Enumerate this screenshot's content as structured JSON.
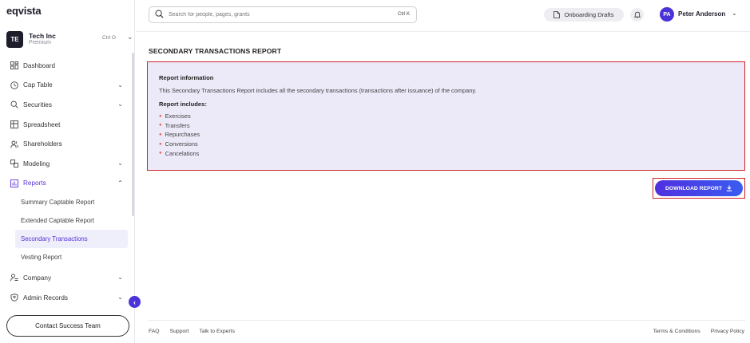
{
  "brand": {
    "logo": "eqvista"
  },
  "company": {
    "initials": "TE",
    "name": "Tech Inc",
    "plan": "Premium",
    "shortcut": "Ctrl O"
  },
  "sidebar": {
    "items": [
      {
        "label": "Dashboard",
        "icon": "dashboard-icon",
        "chevron": ""
      },
      {
        "label": "Cap Table",
        "icon": "clock-icon",
        "chevron": "⌄"
      },
      {
        "label": "Securities",
        "icon": "securities-icon",
        "chevron": "⌄"
      },
      {
        "label": "Spreadsheet",
        "icon": "grid-icon",
        "chevron": ""
      },
      {
        "label": "Shareholders",
        "icon": "users-icon",
        "chevron": ""
      },
      {
        "label": "Modeling",
        "icon": "modeling-icon",
        "chevron": "⌄"
      },
      {
        "label": "Reports",
        "icon": "reports-icon",
        "chevron": "⌃"
      }
    ],
    "report_subitems": [
      "Summary Captable Report",
      "Extended Captable Report",
      "Secondary Transactions",
      "Vesting Report"
    ],
    "bottom_items": [
      {
        "label": "Company",
        "icon": "company-icon",
        "chevron": "⌄"
      },
      {
        "label": "Admin Records",
        "icon": "admin-icon",
        "chevron": "⌄"
      }
    ],
    "contact_label": "Contact Success Team",
    "collapse_glyph": "‹"
  },
  "topbar": {
    "search_placeholder": "Search for people, pages, grants",
    "search_shortcut": "Ctrl K",
    "drafts_label": "Onboarding Drafts",
    "user_initials": "PA",
    "user_name": "Peter Anderson"
  },
  "main": {
    "title": "SECONDARY TRANSACTIONS REPORT",
    "info_heading": "Report information",
    "info_desc": "This Secondary Transactions Report includes all the secondary transactions (transactions after issuance) of the company.",
    "includes_heading": "Report includes:",
    "includes": [
      "Exercises",
      "Transfers",
      "Repurchases",
      "Conversions",
      "Cancelations"
    ],
    "download_label": "DOWNLOAD REPORT"
  },
  "footer": {
    "left": [
      "FAQ",
      "Support",
      "Talk to Experts"
    ],
    "right": [
      "Terms & Conditions",
      "Privacy Policy"
    ]
  },
  "colors": {
    "accent": "#5b32d6",
    "button": "#4a33d8",
    "highlight_border": "#d1232a",
    "info_bg": "#ece9f8"
  }
}
